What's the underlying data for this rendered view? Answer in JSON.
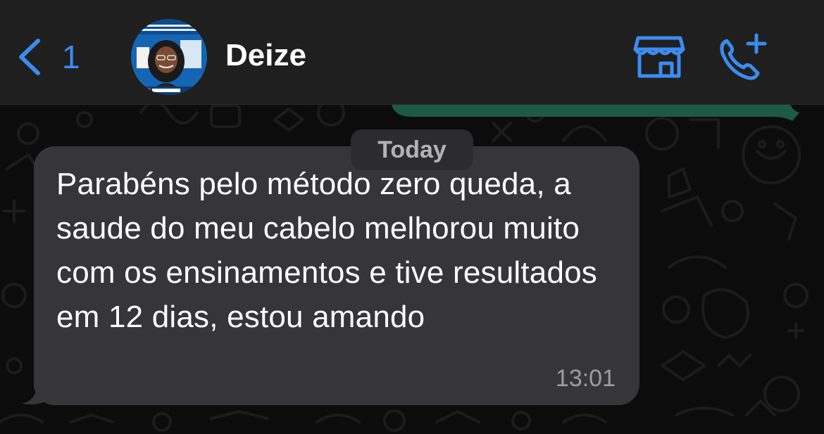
{
  "header": {
    "back_count": "1",
    "contact_name": "Deize",
    "avatar_icon": "contact-photo",
    "store_icon": "storefront-icon",
    "call_icon": "add-call-icon",
    "accent_color": "#3b8cf0"
  },
  "chat": {
    "date_separator": "Today",
    "messages": [
      {
        "direction": "incoming",
        "text": "Parabéns pelo método zero queda, a saude do meu cabelo melhorou muito com os ensinamentos e tive resultados em 12 dias, estou amando",
        "time": "13:01"
      }
    ]
  },
  "colors": {
    "header_bg": "#1f1f1f",
    "chat_bg": "#0c0c0c",
    "incoming_bubble": "#363638",
    "outgoing_bubble": "#1e5c46"
  }
}
